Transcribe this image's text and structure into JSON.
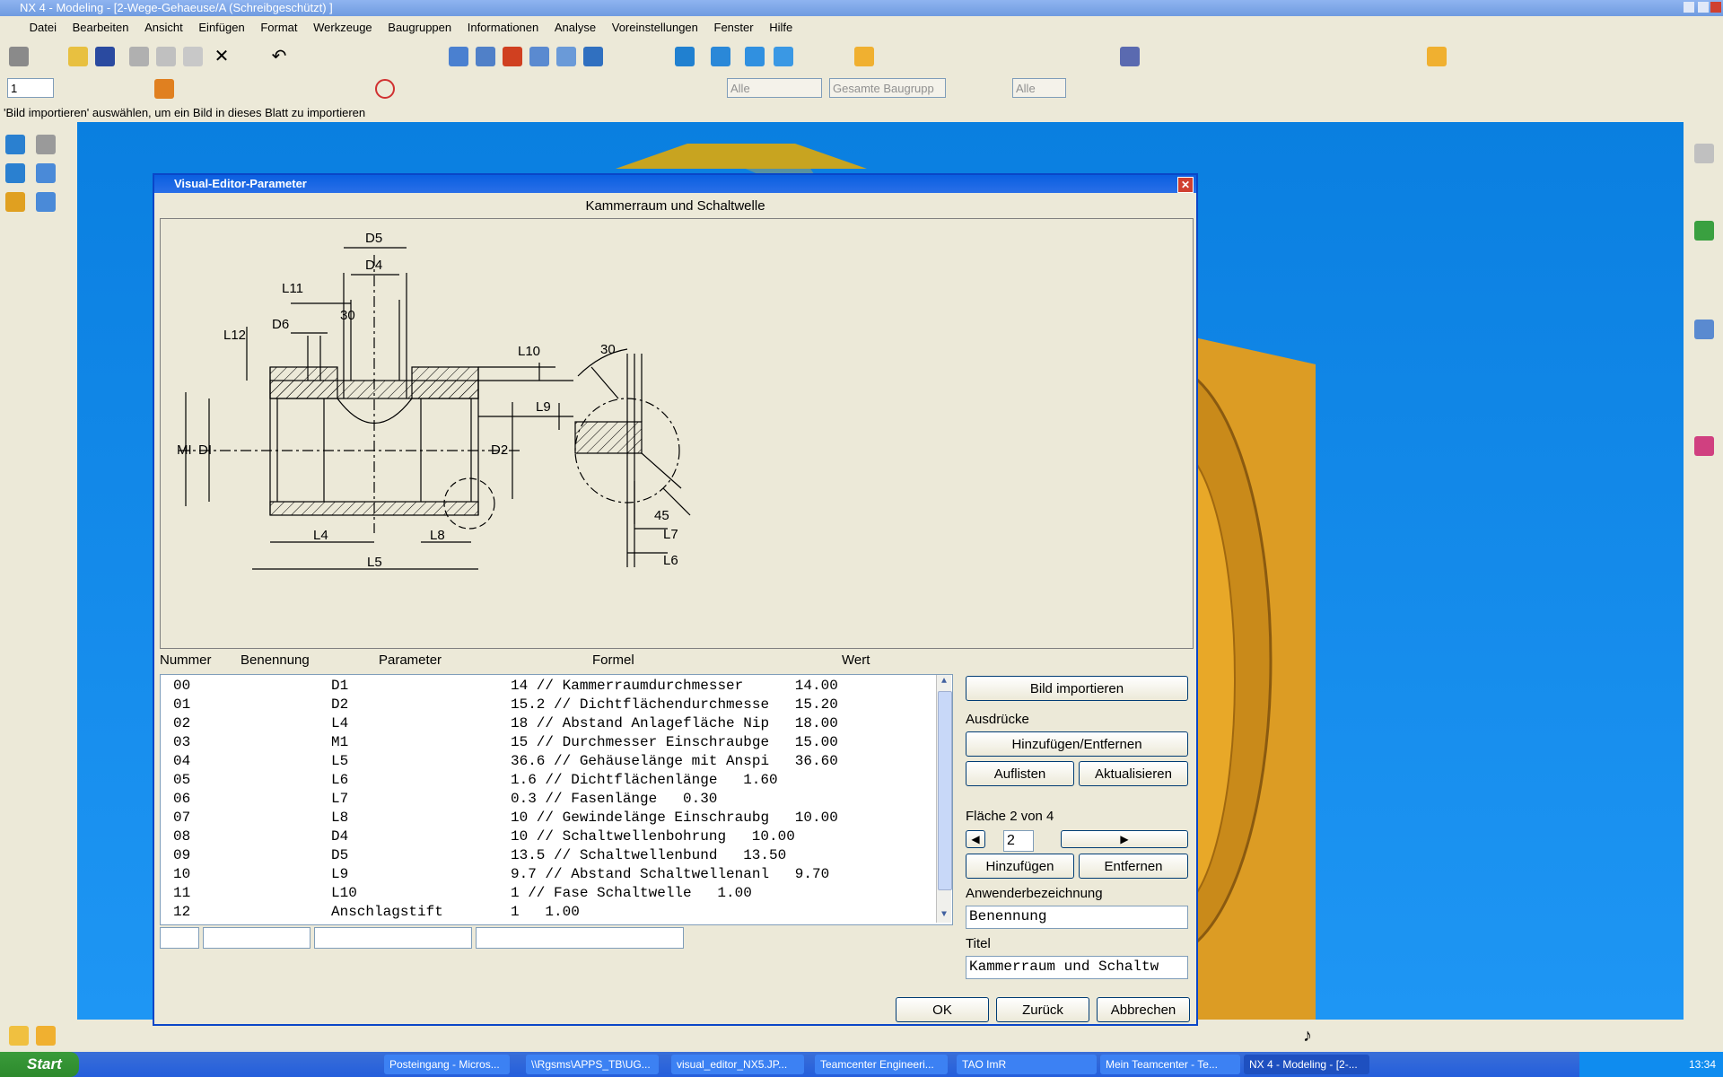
{
  "window_title": "NX 4 - Modeling - [2-Wege-Gehaeuse/A (Schreibgeschützt) ]",
  "menu": [
    "Datei",
    "Bearbeiten",
    "Ansicht",
    "Einfügen",
    "Format",
    "Werkzeuge",
    "Baugruppen",
    "Informationen",
    "Analyse",
    "Voreinstellungen",
    "Fenster",
    "Hilfe"
  ],
  "toolbar2": {
    "layer_value": "1",
    "filter1": "Alle",
    "filter2": "Gesamte Baugrupp",
    "filter3": "Alle"
  },
  "status_message": "'Bild importieren' auswählen, um ein Bild in dieses Blatt zu importieren",
  "dialog": {
    "title": "Visual-Editor-Parameter",
    "picture_title": "Kammerraum und Schaltwelle",
    "column_headers": [
      "Nummer",
      "Benennung",
      "Parameter",
      "Formel",
      "Wert"
    ],
    "rows": [
      {
        "nr": "00",
        "param": "D1",
        "formula": "14 // Kammerraumdurchmesser",
        "value": "14.00"
      },
      {
        "nr": "01",
        "param": "D2",
        "formula": "15.2 // Dichtflächendurchmesse",
        "value": "15.20"
      },
      {
        "nr": "02",
        "param": "L4",
        "formula": "18 // Abstand Anlagefläche Nip",
        "value": "18.00"
      },
      {
        "nr": "03",
        "param": "M1",
        "formula": "15 // Durchmesser Einschraubge",
        "value": "15.00"
      },
      {
        "nr": "04",
        "param": "L5",
        "formula": "36.6 // Gehäuselänge mit Anspi",
        "value": "36.60"
      },
      {
        "nr": "05",
        "param": "L6",
        "formula": "1.6 // Dichtflächenlänge",
        "value": "1.60"
      },
      {
        "nr": "06",
        "param": "L7",
        "formula": "0.3 // Fasenlänge",
        "value": "0.30"
      },
      {
        "nr": "07",
        "param": "L8",
        "formula": "10 // Gewindelänge Einschraubg",
        "value": "10.00"
      },
      {
        "nr": "08",
        "param": "D4",
        "formula": "10 // Schaltwellenbohrung",
        "value": "10.00"
      },
      {
        "nr": "09",
        "param": "D5",
        "formula": "13.5 // Schaltwellenbund",
        "value": "13.50"
      },
      {
        "nr": "10",
        "param": "L9",
        "formula": "9.7 // Abstand Schaltwellenanl",
        "value": "9.70"
      },
      {
        "nr": "11",
        "param": "L10",
        "formula": "1 // Fase Schaltwelle",
        "value": "1.00"
      },
      {
        "nr": "12",
        "param": "Anschlagstift",
        "formula": "1",
        "value": "1.00"
      }
    ],
    "buttons": {
      "import": "Bild importieren",
      "add_remove": "Hinzufügen/Entfernen",
      "list": "Auflisten",
      "update": "Aktualisieren",
      "add": "Hinzufügen",
      "remove": "Entfernen",
      "ok": "OK",
      "back": "Zurück",
      "cancel": "Abbrechen"
    },
    "labels": {
      "expressions": "Ausdrücke",
      "sheet": "Fläche 2 von 4",
      "user_name": "Anwenderbezeichnung",
      "title": "Titel"
    },
    "sheet_value": "2",
    "user_name_value": "Benennung",
    "title_value": "Kammerraum und Schaltw",
    "drawing_labels": {
      "D5": "D5",
      "D4": "D4",
      "L11": "L11",
      "D6": "D6",
      "L12": "L12",
      "ang30a": "30",
      "L10": "L10",
      "L9": "L9",
      "M1": "MI",
      "D1": "DI",
      "D2": "D2",
      "L4": "L4",
      "L8": "L8",
      "L5": "L5",
      "ang30b": "30",
      "ang45": "45",
      "L7": "L7",
      "L6": "L6"
    }
  },
  "taskbar": {
    "start": "Start",
    "tasks": [
      "Posteingang - Micros...",
      "\\\\Rgsms\\APPS_TB\\UG...",
      "visual_editor_NX5.JP...",
      "Teamcenter Engineeri...",
      "TAO ImR",
      "Mein Teamcenter - Te...",
      "NX 4 - Modeling - [2-..."
    ],
    "clock": "13:34"
  },
  "icon_names": [
    "open-icon",
    "save-icon",
    "cut-icon",
    "copy-icon",
    "paste-icon",
    "delete-icon",
    "undo-icon",
    "zoom-icon",
    "rotate-icon",
    "view-cube-icon",
    "tiff-icon"
  ],
  "colors": {
    "titlebar": "#0a5fe0",
    "viewport": "#1e96f4",
    "part": "#e0a020",
    "dialog_bg": "#ece9d8"
  }
}
